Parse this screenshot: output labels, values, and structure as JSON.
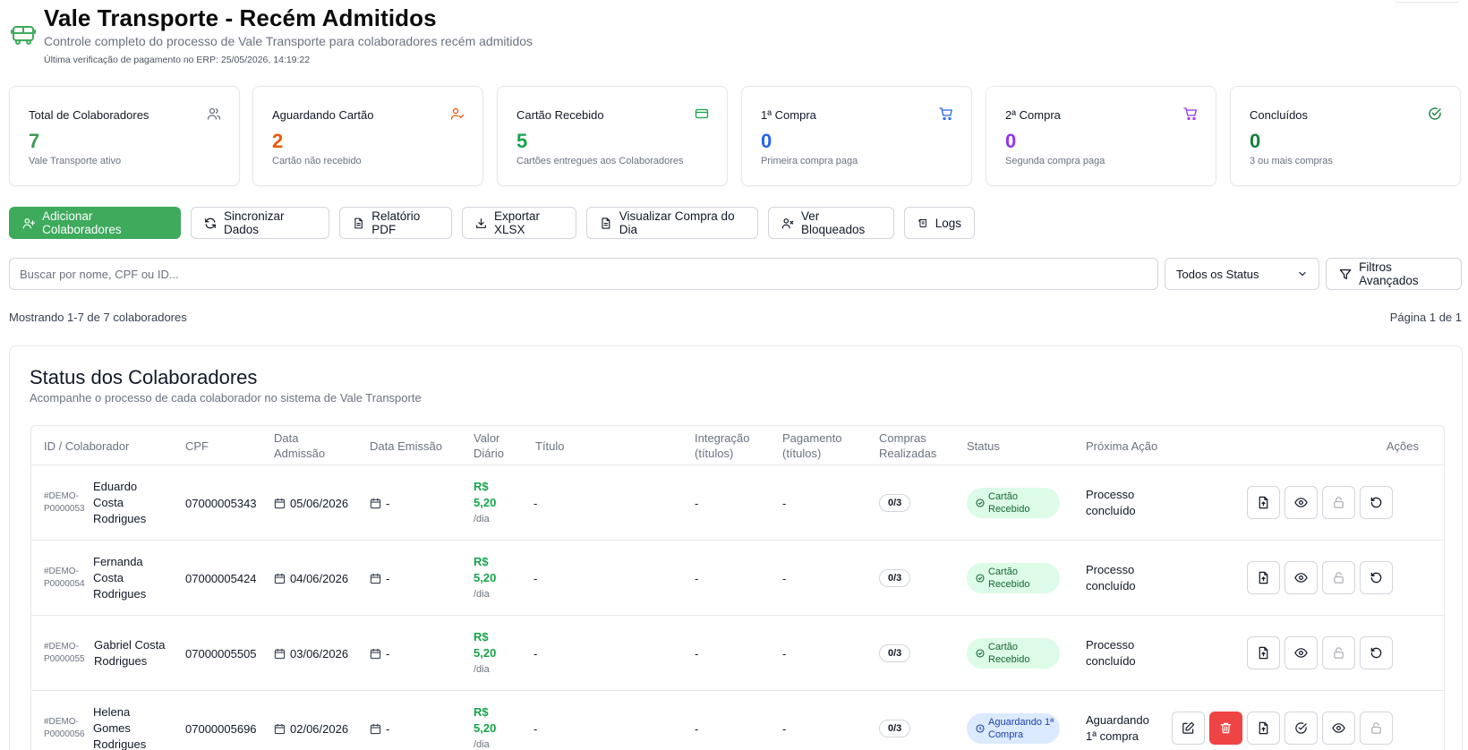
{
  "header": {
    "title": "Vale Transporte - Recém Admitidos",
    "subtitle": "Controle completo do processo de Vale Transporte para colaboradores recém admitidos",
    "last_check": "Última verificação de pagamento no ERP: 25/05/2026, 14:19:22"
  },
  "stats": [
    {
      "title": "Total de Colaboradores",
      "value": "7",
      "desc": "Vale Transporte ativo",
      "icon": "users-icon",
      "color": "#3d9a4f"
    },
    {
      "title": "Aguardando Cartão",
      "value": "2",
      "desc": "Cartão não recebido",
      "icon": "user-clock-icon",
      "color": "#ea580c"
    },
    {
      "title": "Cartão Recebido",
      "value": "5",
      "desc": "Cartões entregues aos Colaboradores",
      "icon": "credit-card-icon",
      "color": "#16a34a"
    },
    {
      "title": "1ª Compra",
      "value": "0",
      "desc": "Primeira compra paga",
      "icon": "cart-icon",
      "color": "#2563eb"
    },
    {
      "title": "2ª Compra",
      "value": "0",
      "desc": "Segunda compra paga",
      "icon": "cart-icon",
      "color": "#9333ea"
    },
    {
      "title": "Concluídos",
      "value": "0",
      "desc": "3 ou mais compras",
      "icon": "check-circle-icon",
      "color": "#15803d"
    }
  ],
  "toolbar": {
    "add": "Adicionar Colaboradores",
    "sync": "Sincronizar Dados",
    "pdf": "Relatório PDF",
    "xlsx": "Exportar XLSX",
    "daily": "Visualizar Compra do Dia",
    "blocked": "Ver Bloqueados",
    "logs": "Logs"
  },
  "search": {
    "placeholder": "Buscar por nome, CPF ou ID..."
  },
  "status_filter": {
    "selected": "Todos os Status"
  },
  "advanced_filters": "Filtros Avançados",
  "pagination": {
    "showing": "Mostrando 1-7 de 7 colaboradores",
    "page": "Página 1 de 1"
  },
  "panel": {
    "title": "Status dos Colaboradores",
    "subtitle": "Acompanhe o processo de cada colaborador no sistema de Vale Transporte"
  },
  "table": {
    "headers": {
      "id": "ID / Colaborador",
      "cpf": "CPF",
      "admission": "Data Admissão",
      "emission": "Data Emissão",
      "daily": "Valor Diário",
      "title": "Título",
      "integration": "Integração (títulos)",
      "payment": "Pagamento (títulos)",
      "purchases": "Compras Realizadas",
      "status": "Status",
      "next": "Próxima Ação",
      "actions": "Ações"
    },
    "rows": [
      {
        "id": "#DEMO-P0000053",
        "name": "Eduardo Costa Rodrigues",
        "cpf": "07000005343",
        "admission": "05/06/2026",
        "emission": "-",
        "daily": "R$ 5,20",
        "per": "/dia",
        "title": "-",
        "integration": "-",
        "payment": "-",
        "purchases": "0/3",
        "status": "Cartão Recebido",
        "next": "Processo concluído"
      },
      {
        "id": "#DEMO-P0000054",
        "name": "Fernanda Costa Rodrigues",
        "cpf": "07000005424",
        "admission": "04/06/2026",
        "emission": "-",
        "daily": "R$ 5,20",
        "per": "/dia",
        "title": "-",
        "integration": "-",
        "payment": "-",
        "purchases": "0/3",
        "status": "Cartão Recebido",
        "next": "Processo concluído"
      },
      {
        "id": "#DEMO-P0000055",
        "name": "Gabriel Costa Rodrigues",
        "cpf": "07000005505",
        "admission": "03/06/2026",
        "emission": "-",
        "daily": "R$ 5,20",
        "per": "/dia",
        "title": "-",
        "integration": "-",
        "payment": "-",
        "purchases": "0/3",
        "status": "Cartão Recebido",
        "next": "Processo concluído"
      },
      {
        "id": "#DEMO-P0000056",
        "name": "Helena Gomes Rodrigues",
        "cpf": "07000005696",
        "admission": "02/06/2026",
        "emission": "-",
        "daily": "R$ 5,20",
        "per": "/dia",
        "title": "-",
        "integration": "-",
        "payment": "-",
        "purchases": "0/3",
        "status": "Aguardando 1ª Compra",
        "next": "Aguardando 1ª compra"
      }
    ]
  }
}
